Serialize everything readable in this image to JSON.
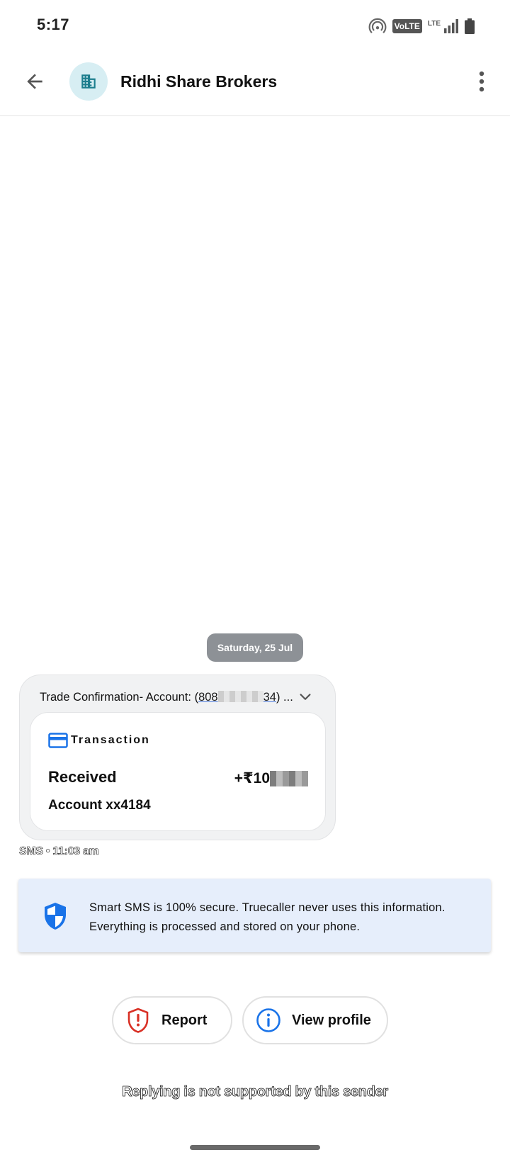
{
  "status_bar": {
    "time": "5:17",
    "volte": "VoLTE",
    "lte": "LTE",
    "icons": [
      "hotspot-icon",
      "signal-icon",
      "battery-icon"
    ]
  },
  "app_bar": {
    "contact_name": "Ridhi Share Brokers",
    "avatar_icon": "building-icon",
    "back_icon": "arrow-left-icon",
    "menu_icon": "more-vert-icon",
    "avatar_bg": "#d7eef3",
    "avatar_fg": "#1d7e8e"
  },
  "conversation": {
    "date_chip": "Saturday, 25 Jul",
    "message": {
      "subject_prefix": "Trade Confirmation- Account: (",
      "account_link_start": "808",
      "account_link_end": "34",
      "subject_suffix": ") ...",
      "card": {
        "type_label": "Transaction",
        "status": "Received",
        "amount_visible": "+₹10",
        "account": "Account xx4184"
      },
      "meta": "SMS • 11:03 am"
    }
  },
  "info_banner": {
    "text": "Smart SMS is 100% secure. Truecaller never uses this information. Everything is processed and stored on your phone.",
    "icon": "shield-icon",
    "bg": "#e6eefb",
    "accent": "#1a73e8"
  },
  "actions": {
    "report_label": "Report",
    "profile_label": "View profile",
    "report_color": "#d93025",
    "profile_color": "#1a73e8"
  },
  "footer": {
    "reply_note": "Replying is not supported by this sender"
  }
}
